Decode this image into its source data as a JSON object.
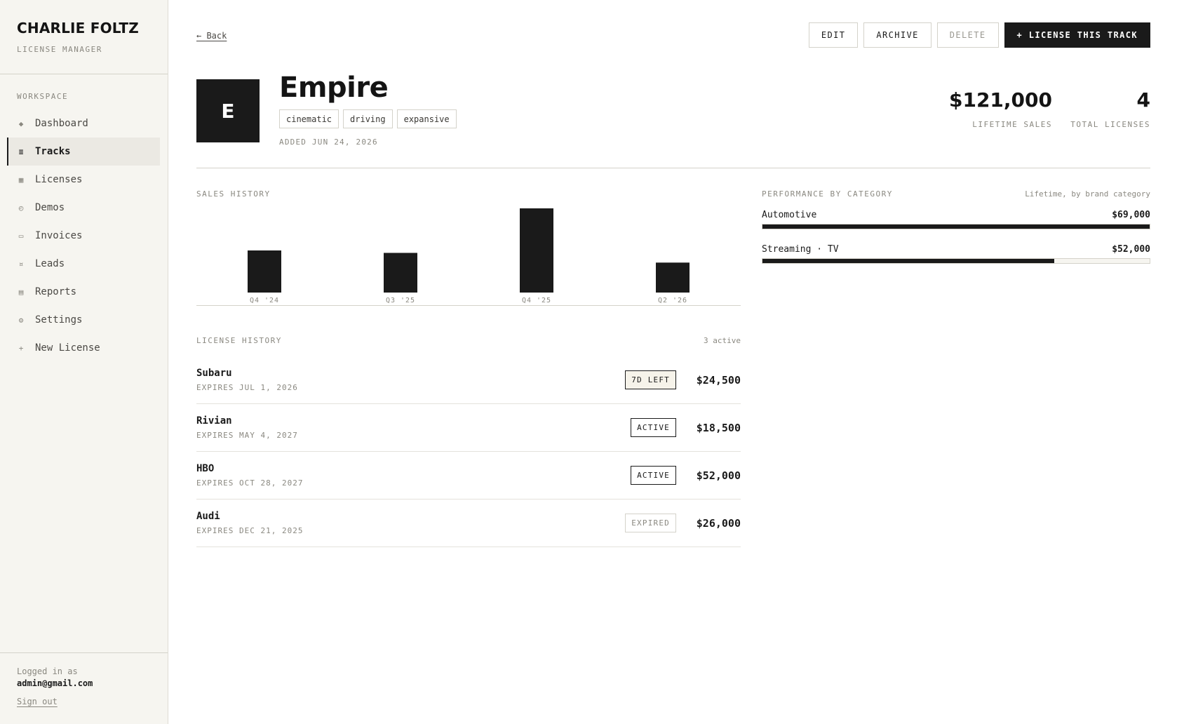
{
  "sidebar": {
    "brand": "CHARLIE FOLTZ",
    "subtitle": "LICENSE MANAGER",
    "section": "WORKSPACE",
    "items": [
      {
        "label": "Dashboard",
        "icon": "◆"
      },
      {
        "label": "Tracks",
        "icon": "≡"
      },
      {
        "label": "Licenses",
        "icon": "▦"
      },
      {
        "label": "Demos",
        "icon": "◴"
      },
      {
        "label": "Invoices",
        "icon": "▭"
      },
      {
        "label": "Leads",
        "icon": "¤"
      },
      {
        "label": "Reports",
        "icon": "▤"
      },
      {
        "label": "Settings",
        "icon": "⚙"
      },
      {
        "label": "New License",
        "icon": "+"
      }
    ],
    "footer": {
      "logged_label": "Logged in as",
      "email": "admin@gmail.com",
      "signout": "Sign out"
    }
  },
  "toolbar": {
    "back": "← Back",
    "edit": "EDIT",
    "archive": "ARCHIVE",
    "delete": "DELETE",
    "license": "+ LICENSE THIS TRACK"
  },
  "track": {
    "cover_letter": "E",
    "title": "Empire",
    "tags": [
      "cinematic",
      "driving",
      "expansive"
    ],
    "added": "ADDED JUN 24, 2026",
    "lifetime_sales": "$121,000",
    "lifetime_label": "LIFETIME SALES",
    "total_licenses": "4",
    "total_label": "TOTAL LICENSES"
  },
  "sales": {
    "label": "SALES HISTORY"
  },
  "chart_data": {
    "type": "bar",
    "categories": [
      "Q4 '24",
      "Q3 '25",
      "Q4 '25",
      "Q2 '26"
    ],
    "values": [
      26000,
      24500,
      52000,
      18500
    ],
    "title": "SALES HISTORY",
    "ylim": [
      0,
      52000
    ]
  },
  "license_history": {
    "label": "LICENSE HISTORY",
    "count": "3 active",
    "rows": [
      {
        "name": "Subaru",
        "expires": "EXPIRES JUL 1, 2026",
        "status": "7D LEFT",
        "status_type": "warn",
        "amount": "$24,500"
      },
      {
        "name": "Rivian",
        "expires": "EXPIRES MAY 4, 2027",
        "status": "ACTIVE",
        "status_type": "active",
        "amount": "$18,500"
      },
      {
        "name": "HBO",
        "expires": "EXPIRES OCT 28, 2027",
        "status": "ACTIVE",
        "status_type": "active",
        "amount": "$52,000"
      },
      {
        "name": "Audi",
        "expires": "EXPIRES DEC 21, 2025",
        "status": "EXPIRED",
        "status_type": "expired",
        "amount": "$26,000"
      }
    ]
  },
  "performance": {
    "label": "PERFORMANCE BY CATEGORY",
    "note": "Lifetime, by brand category",
    "rows": [
      {
        "name": "Automotive",
        "amount": "$69,000",
        "share": 1.0
      },
      {
        "name": "Streaming · TV",
        "amount": "$52,000",
        "share": 0.754
      }
    ]
  }
}
